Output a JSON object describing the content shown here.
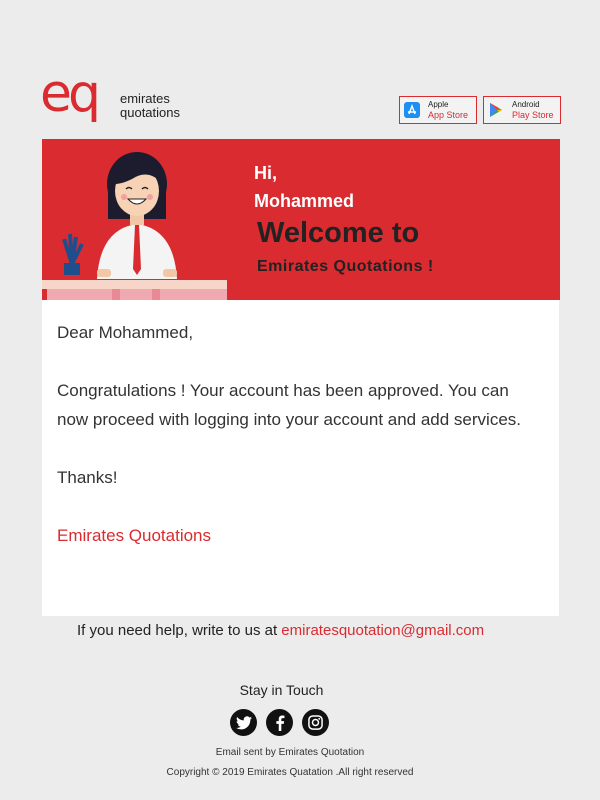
{
  "brand": {
    "logo_mark": "eq",
    "logo_line1": "emirates",
    "logo_line2": "quotations",
    "accent_color": "#d92b30"
  },
  "stores": [
    {
      "line1": "Apple",
      "line2": "App Store",
      "icon": "app-store-icon"
    },
    {
      "line1": "Android",
      "line2": "Play Store",
      "icon": "play-store-icon"
    }
  ],
  "banner": {
    "hi": "Hi,",
    "name": "Mohammed",
    "welcome": "Welcome to",
    "company": "Emirates Quotations !"
  },
  "body": {
    "salutation": "Dear Mohammed,",
    "message": "Congratulations ! Your account has been approved. You can now proceed with logging into your account and add services.",
    "thanks": "Thanks!",
    "signature": "Emirates Quotations"
  },
  "footer": {
    "help_text": "If you need help, write to us at ",
    "help_email": "emiratesquotation@gmail.com",
    "stay_in_touch": "Stay in Touch",
    "social": [
      "twitter-icon",
      "facebook-icon",
      "instagram-icon"
    ],
    "sent_by": "Email sent by Emirates Quotation",
    "copyright": "Copyright ©  2019 Emirates Quatation .All right reserved"
  }
}
